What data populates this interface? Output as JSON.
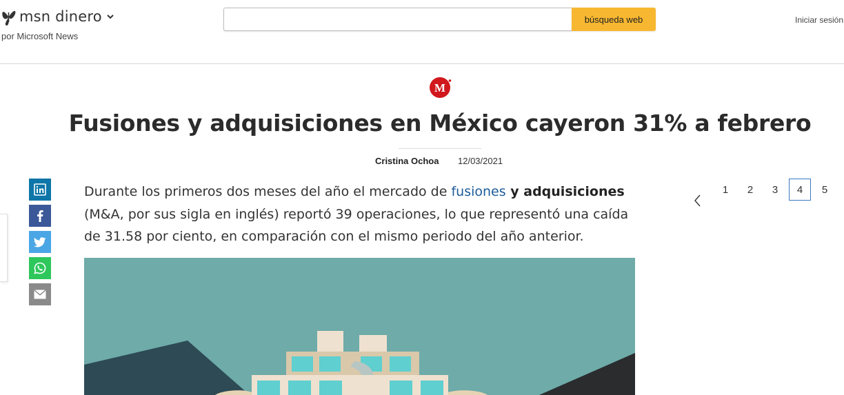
{
  "header": {
    "brand_name": "msn dinero",
    "byline": "por Microsoft News",
    "search_placeholder": "",
    "search_button": "búsqueda web",
    "signin": "Iniciar sesión"
  },
  "article": {
    "source_logo_letter": "M",
    "title": "Fusiones y adquisiciones en México cayeron 31% a febrero",
    "author": "Cristina Ochoa",
    "date": "12/03/2021",
    "para_1": "Durante los primeros dos meses del año el mercado de ",
    "para_link": "fusiones",
    "para_bold": " y adquisiciones",
    "para_2": " (M&A, por sus sigla en inglés) reportó 39 operaciones, lo que representó una caída de 31.58 por ciento, en comparación con el mismo periodo del año anterior."
  },
  "share": {
    "icons": [
      "linkedin-icon",
      "facebook-icon",
      "twitter-icon",
      "whatsapp-icon",
      "email-icon"
    ]
  },
  "pager": {
    "pages": [
      "1",
      "2",
      "3",
      "4",
      "5"
    ],
    "active": "4"
  },
  "colors": {
    "search_button": "#f7b730",
    "link": "#1b5c9a",
    "linkedin": "#0e76a8",
    "facebook": "#3b5998",
    "twitter": "#4aa6e5",
    "whatsapp": "#2ec75c",
    "email": "#8a8a8a",
    "source_logo": "#d0181d",
    "hero_background": "#6eaba9"
  }
}
